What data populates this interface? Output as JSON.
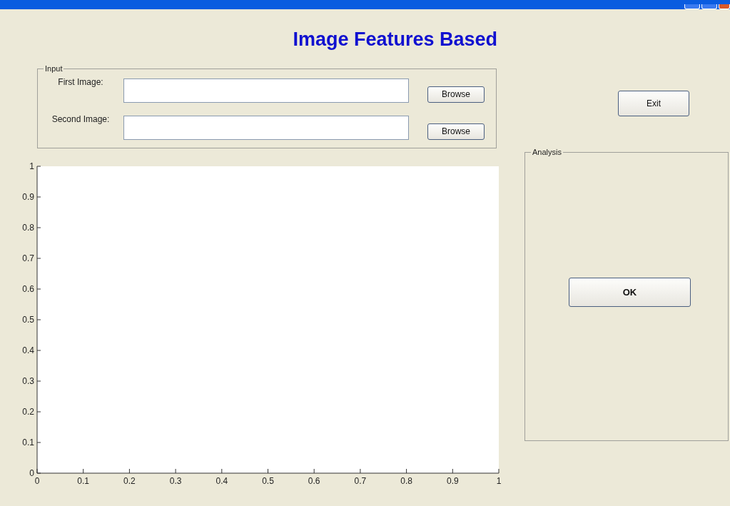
{
  "title": "Image Features Based",
  "input_panel": {
    "legend": "Input",
    "rows": [
      {
        "label": "First Image:",
        "value": "",
        "button": "Browse"
      },
      {
        "label": "Second Image:",
        "value": "",
        "button": "Browse"
      }
    ]
  },
  "exit_button": "Exit",
  "analysis_panel": {
    "legend": "Analysis",
    "button": "OK"
  },
  "axes": {
    "chart_data": {
      "type": "line",
      "xlim": [
        0,
        1
      ],
      "ylim": [
        0,
        1
      ],
      "xticks": [
        {
          "value": 0,
          "label": "0"
        },
        {
          "value": 0.1,
          "label": "0.1"
        },
        {
          "value": 0.2,
          "label": "0.2"
        },
        {
          "value": 0.3,
          "label": "0.3"
        },
        {
          "value": 0.4,
          "label": "0.4"
        },
        {
          "value": 0.5,
          "label": "0.5"
        },
        {
          "value": 0.6,
          "label": "0.6"
        },
        {
          "value": 0.7,
          "label": "0.7"
        },
        {
          "value": 0.8,
          "label": "0.8"
        },
        {
          "value": 0.9,
          "label": "0.9"
        },
        {
          "value": 1,
          "label": "1"
        }
      ],
      "yticks": [
        {
          "value": 0,
          "label": "0"
        },
        {
          "value": 0.1,
          "label": "0.1"
        },
        {
          "value": 0.2,
          "label": "0.2"
        },
        {
          "value": 0.3,
          "label": "0.3"
        },
        {
          "value": 0.4,
          "label": "0.4"
        },
        {
          "value": 0.5,
          "label": "0.5"
        },
        {
          "value": 0.6,
          "label": "0.6"
        },
        {
          "value": 0.7,
          "label": "0.7"
        },
        {
          "value": 0.8,
          "label": "0.8"
        },
        {
          "value": 0.9,
          "label": "0.9"
        },
        {
          "value": 1,
          "label": "1"
        }
      ]
    }
  }
}
